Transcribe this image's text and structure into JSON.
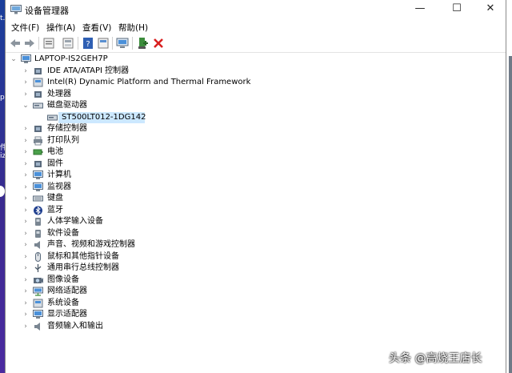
{
  "window": {
    "title": "设备管理器",
    "controls": {
      "minimize": "—",
      "maximize": "☐",
      "close": "✕"
    }
  },
  "menu": [
    "文件(F)",
    "操作(A)",
    "查看(V)",
    "帮助(H)"
  ],
  "toolbar": [
    "back-arrow",
    "forward-arrow",
    "properties-sheet",
    "show-hidden",
    "help-book",
    "update-driver",
    "scan-hardware",
    "add-legacy",
    "uninstall-x"
  ],
  "tree": {
    "root": "LAPTOP-IS2GEH7P",
    "items": [
      {
        "label": "IDE ATA/ATAPI 控制器",
        "icon": "ide-controller-icon",
        "expanded": false
      },
      {
        "label": "Intel(R) Dynamic Platform and Thermal Framework",
        "icon": "thermal-icon",
        "expanded": false
      },
      {
        "label": "处理器",
        "icon": "processor-icon",
        "expanded": false
      },
      {
        "label": "磁盘驱动器",
        "icon": "disk-drive-icon",
        "expanded": true,
        "children": [
          {
            "label": "ST500LT012-1DG142",
            "icon": "disk-icon",
            "selected": true
          }
        ]
      },
      {
        "label": "存储控制器",
        "icon": "storage-controller-icon",
        "expanded": false
      },
      {
        "label": "打印队列",
        "icon": "printer-icon",
        "expanded": false
      },
      {
        "label": "电池",
        "icon": "battery-icon",
        "expanded": false
      },
      {
        "label": "固件",
        "icon": "firmware-icon",
        "expanded": false
      },
      {
        "label": "计算机",
        "icon": "computer-icon",
        "expanded": false
      },
      {
        "label": "监视器",
        "icon": "monitor-icon",
        "expanded": false
      },
      {
        "label": "键盘",
        "icon": "keyboard-icon",
        "expanded": false
      },
      {
        "label": "蓝牙",
        "icon": "bluetooth-icon",
        "expanded": false
      },
      {
        "label": "人体学输入设备",
        "icon": "hid-icon",
        "expanded": false
      },
      {
        "label": "软件设备",
        "icon": "software-device-icon",
        "expanded": false
      },
      {
        "label": "声音、视频和游戏控制器",
        "icon": "sound-icon",
        "expanded": false
      },
      {
        "label": "鼠标和其他指针设备",
        "icon": "mouse-icon",
        "expanded": false
      },
      {
        "label": "通用串行总线控制器",
        "icon": "usb-icon",
        "expanded": false
      },
      {
        "label": "图像设备",
        "icon": "camera-icon",
        "expanded": false
      },
      {
        "label": "网络适配器",
        "icon": "network-icon",
        "expanded": false
      },
      {
        "label": "系统设备",
        "icon": "system-device-icon",
        "expanded": false
      },
      {
        "label": "显示适配器",
        "icon": "display-adapter-icon",
        "expanded": false
      },
      {
        "label": "音频输入和输出",
        "icon": "audio-io-icon",
        "expanded": false
      }
    ]
  },
  "desktop_fragments": [
    "t.",
    "p",
    "件",
    "iz"
  ],
  "watermark": "头条 @高烧王店长",
  "colors": {
    "selection": "#cce8ff",
    "desktop": "#1b4fa6",
    "accent_blue": "#1e73c8"
  }
}
